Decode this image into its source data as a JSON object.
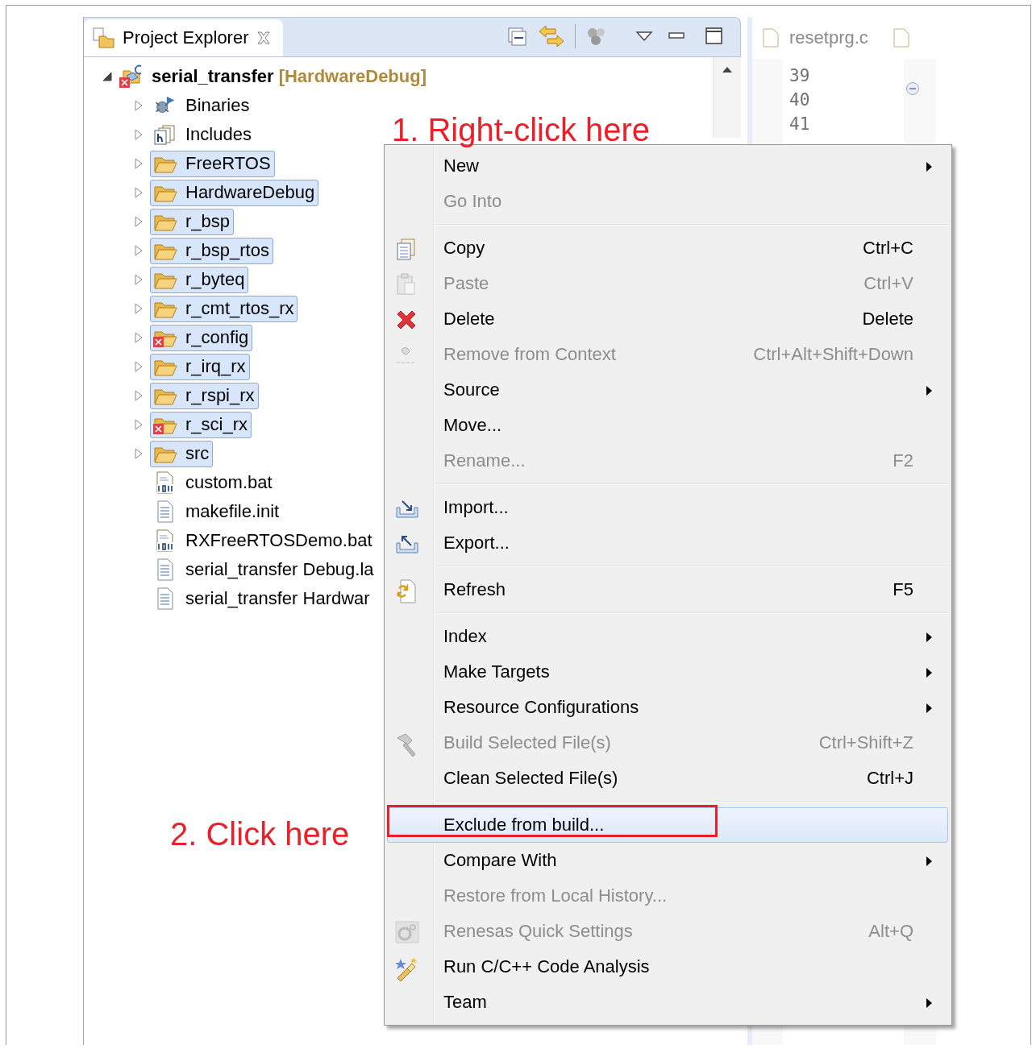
{
  "explorer": {
    "title": "Project Explorer",
    "project": {
      "name": "serial_transfer",
      "config": "[HardwareDebug]",
      "expanded": true,
      "error": true
    },
    "items": [
      {
        "label": "Binaries",
        "kind": "binaries",
        "selected": false,
        "error": false
      },
      {
        "label": "Includes",
        "kind": "includes",
        "selected": false,
        "error": false
      },
      {
        "label": "FreeRTOS",
        "kind": "folder",
        "selected": true,
        "error": false
      },
      {
        "label": "HardwareDebug",
        "kind": "folder",
        "selected": true,
        "error": false
      },
      {
        "label": "r_bsp",
        "kind": "folder",
        "selected": true,
        "error": false
      },
      {
        "label": "r_bsp_rtos",
        "kind": "folder",
        "selected": true,
        "error": false
      },
      {
        "label": "r_byteq",
        "kind": "folder",
        "selected": true,
        "error": false
      },
      {
        "label": "r_cmt_rtos_rx",
        "kind": "folder",
        "selected": true,
        "error": false
      },
      {
        "label": "r_config",
        "kind": "folder",
        "selected": true,
        "error": true
      },
      {
        "label": "r_irq_rx",
        "kind": "folder",
        "selected": true,
        "error": false
      },
      {
        "label": "r_rspi_rx",
        "kind": "folder",
        "selected": true,
        "error": false
      },
      {
        "label": "r_sci_rx",
        "kind": "folder",
        "selected": true,
        "error": true
      },
      {
        "label": "src",
        "kind": "folder",
        "selected": true,
        "error": false
      },
      {
        "label": "custom.bat",
        "kind": "binary-file",
        "selected": false,
        "error": false
      },
      {
        "label": "makefile.init",
        "kind": "text-file",
        "selected": false,
        "error": false
      },
      {
        "label": "RXFreeRTOSDemo.bat",
        "kind": "binary-file",
        "selected": false,
        "error": false
      },
      {
        "label": "serial_transfer Debug.la",
        "kind": "text-file",
        "selected": false,
        "error": false
      },
      {
        "label": "serial_transfer Hardwar",
        "kind": "text-file",
        "selected": false,
        "error": false
      }
    ]
  },
  "editor": {
    "tabs": [
      {
        "label": "resetprg.c",
        "kind": "c-file"
      },
      {
        "kind": "c-file"
      }
    ],
    "line_numbers": [
      "39",
      "40",
      "41"
    ]
  },
  "context_menu": {
    "items": [
      {
        "kind": "plain",
        "label": "New",
        "disabled": false,
        "submenu": true,
        "selected": false,
        "outlined": false
      },
      {
        "kind": "plain",
        "label": "Go Into",
        "disabled": true,
        "submenu": false,
        "selected": false,
        "outlined": false
      },
      {
        "kind": "separator"
      },
      {
        "kind": "copy",
        "label": "Copy",
        "shortcut": "Ctrl+C",
        "disabled": false,
        "submenu": false,
        "selected": false,
        "outlined": false
      },
      {
        "kind": "paste",
        "label": "Paste",
        "shortcut": "Ctrl+V",
        "disabled": true,
        "submenu": false,
        "selected": false,
        "outlined": false
      },
      {
        "kind": "delete",
        "label": "Delete",
        "shortcut": "Delete",
        "disabled": false,
        "submenu": false,
        "selected": false,
        "outlined": false
      },
      {
        "kind": "remove",
        "label": "Remove from Context",
        "shortcut": "Ctrl+Alt+Shift+Down",
        "disabled": true,
        "submenu": false,
        "selected": false,
        "outlined": false
      },
      {
        "kind": "plain",
        "label": "Source",
        "disabled": false,
        "submenu": true,
        "selected": false,
        "outlined": false
      },
      {
        "kind": "plain",
        "label": "Move...",
        "disabled": false,
        "submenu": false,
        "selected": false,
        "outlined": false
      },
      {
        "kind": "plain",
        "label": "Rename...",
        "shortcut": "F2",
        "disabled": true,
        "submenu": false,
        "selected": false,
        "outlined": false
      },
      {
        "kind": "separator"
      },
      {
        "kind": "import",
        "label": "Import...",
        "disabled": false,
        "submenu": false,
        "selected": false,
        "outlined": false
      },
      {
        "kind": "export",
        "label": "Export...",
        "disabled": false,
        "submenu": false,
        "selected": false,
        "outlined": false
      },
      {
        "kind": "separator"
      },
      {
        "kind": "refresh",
        "label": "Refresh",
        "shortcut": "F5",
        "disabled": false,
        "submenu": false,
        "selected": false,
        "outlined": false
      },
      {
        "kind": "separator"
      },
      {
        "kind": "plain",
        "label": "Index",
        "disabled": false,
        "submenu": true,
        "selected": false,
        "outlined": false
      },
      {
        "kind": "plain",
        "label": "Make Targets",
        "disabled": false,
        "submenu": true,
        "selected": false,
        "outlined": false
      },
      {
        "kind": "plain",
        "label": "Resource Configurations",
        "disabled": false,
        "submenu": true,
        "selected": false,
        "outlined": false
      },
      {
        "kind": "build",
        "label": "Build Selected File(s)",
        "shortcut": "Ctrl+Shift+Z",
        "disabled": true,
        "submenu": false,
        "selected": false,
        "outlined": false
      },
      {
        "kind": "plain",
        "label": "Clean Selected File(s)",
        "shortcut": "Ctrl+J",
        "disabled": false,
        "submenu": false,
        "selected": false,
        "outlined": false
      },
      {
        "kind": "separator"
      },
      {
        "kind": "plain",
        "label": "Exclude from build...",
        "disabled": false,
        "submenu": false,
        "selected": true,
        "outlined": true
      },
      {
        "kind": "plain",
        "label": "Compare With",
        "disabled": false,
        "submenu": true,
        "selected": false,
        "outlined": false
      },
      {
        "kind": "plain",
        "label": "Restore from Local History...",
        "disabled": true,
        "submenu": false,
        "selected": false,
        "outlined": false
      },
      {
        "kind": "e2",
        "label": "Renesas Quick Settings",
        "shortcut": "Alt+Q",
        "disabled": true,
        "submenu": false,
        "selected": false,
        "outlined": false
      },
      {
        "kind": "analysis",
        "label": "Run C/C++ Code Analysis",
        "disabled": false,
        "submenu": false,
        "selected": false,
        "outlined": false
      },
      {
        "kind": "plain",
        "label": "Team",
        "disabled": false,
        "submenu": true,
        "selected": false,
        "outlined": false
      }
    ]
  },
  "annotations": [
    {
      "text": "1. Right-click here"
    },
    {
      "text": "2. Click here"
    }
  ]
}
